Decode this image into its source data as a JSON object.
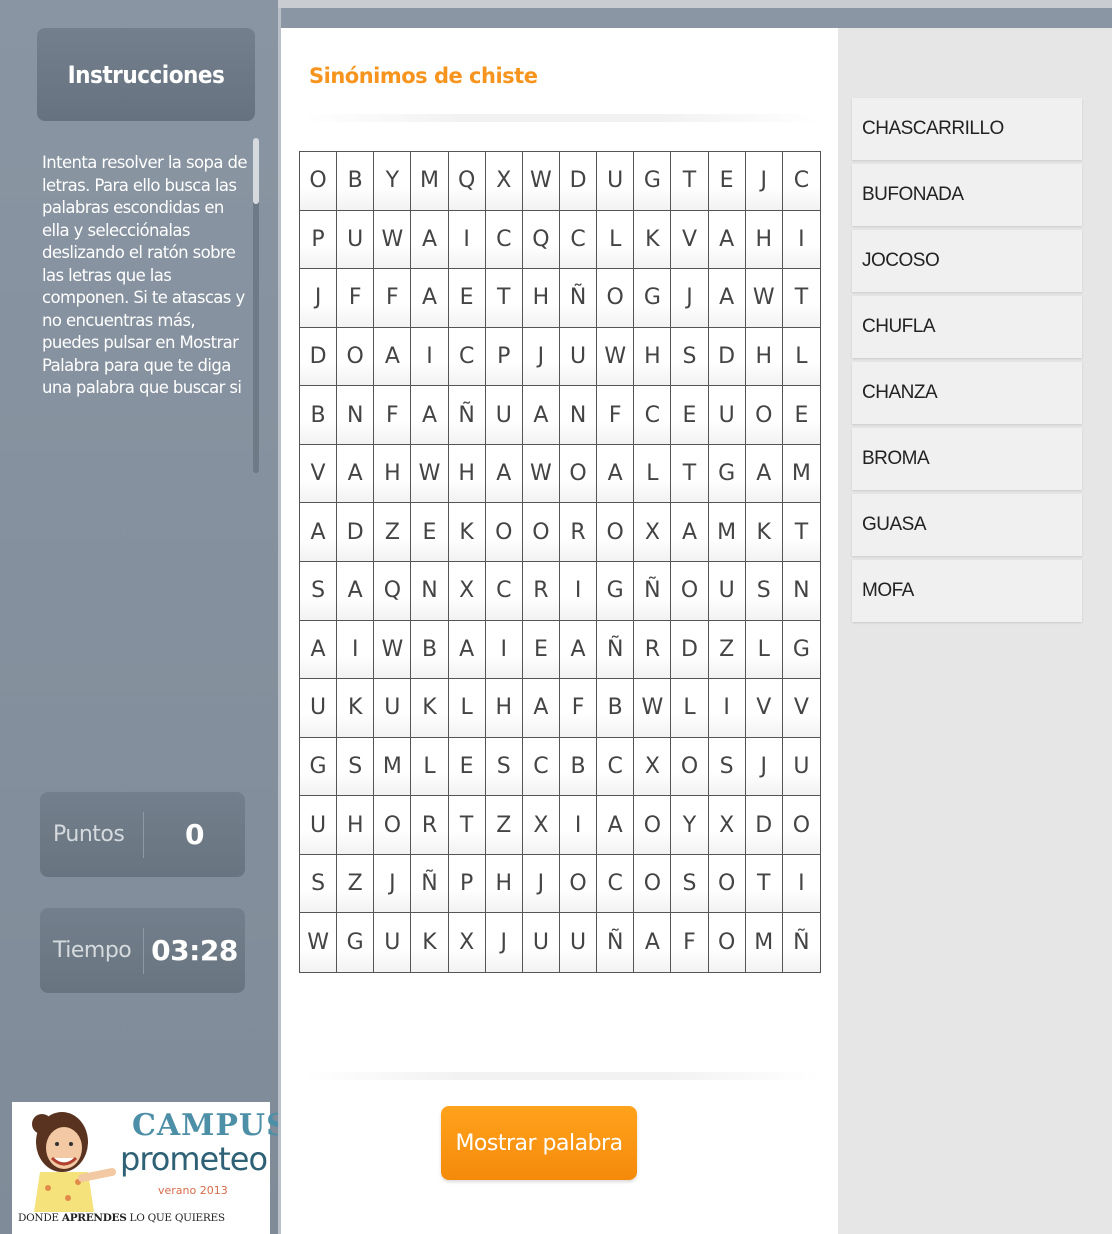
{
  "sidebar": {
    "header": "Instrucciones",
    "instructions": "Intenta resolver la sopa de letras. Para ello busca las palabras escondidas en ella y selecciónalas deslizando el ratón sobre las letras que las componen. Si te atascas y no encuentras más, puedes pulsar en Mostrar Palabra para que te diga una palabra que buscar si",
    "points_label": "Puntos",
    "points_value": "0",
    "time_label": "Tiempo",
    "time_value": "03:28",
    "logo": {
      "campus": "CAMPUS",
      "prometeo": "prometeo",
      "verano": "verano 2013",
      "tagline_pre": "DONDE ",
      "tagline_bold": "APRENDES",
      "tagline_post": " LO QUE QUIERES"
    }
  },
  "main": {
    "title": "Sinónimos de chiste",
    "show_word_button": "Mostrar palabra",
    "grid": [
      [
        "O",
        "B",
        "Y",
        "M",
        "Q",
        "X",
        "W",
        "D",
        "U",
        "G",
        "T",
        "E",
        "J",
        "C"
      ],
      [
        "P",
        "U",
        "W",
        "A",
        "I",
        "C",
        "Q",
        "C",
        "L",
        "K",
        "V",
        "A",
        "H",
        "I"
      ],
      [
        "J",
        "F",
        "F",
        "A",
        "E",
        "T",
        "H",
        "Ñ",
        "O",
        "G",
        "J",
        "A",
        "W",
        "T"
      ],
      [
        "D",
        "O",
        "A",
        "I",
        "C",
        "P",
        "J",
        "U",
        "W",
        "H",
        "S",
        "D",
        "H",
        "L"
      ],
      [
        "B",
        "N",
        "F",
        "A",
        "Ñ",
        "U",
        "A",
        "N",
        "F",
        "C",
        "E",
        "U",
        "O",
        "E"
      ],
      [
        "V",
        "A",
        "H",
        "W",
        "H",
        "A",
        "W",
        "O",
        "A",
        "L",
        "T",
        "G",
        "A",
        "M"
      ],
      [
        "A",
        "D",
        "Z",
        "E",
        "K",
        "O",
        "O",
        "R",
        "O",
        "X",
        "A",
        "M",
        "K",
        "T"
      ],
      [
        "S",
        "A",
        "Q",
        "N",
        "X",
        "C",
        "R",
        "I",
        "G",
        "Ñ",
        "O",
        "U",
        "S",
        "N"
      ],
      [
        "A",
        "I",
        "W",
        "B",
        "A",
        "I",
        "E",
        "A",
        "Ñ",
        "R",
        "D",
        "Z",
        "L",
        "G"
      ],
      [
        "U",
        "K",
        "U",
        "K",
        "L",
        "H",
        "A",
        "F",
        "B",
        "W",
        "L",
        "I",
        "V",
        "V"
      ],
      [
        "G",
        "S",
        "M",
        "L",
        "E",
        "S",
        "C",
        "B",
        "C",
        "X",
        "O",
        "S",
        "J",
        "U"
      ],
      [
        "U",
        "H",
        "O",
        "R",
        "T",
        "Z",
        "X",
        "I",
        "A",
        "O",
        "Y",
        "X",
        "D",
        "O"
      ],
      [
        "S",
        "Z",
        "J",
        "Ñ",
        "P",
        "H",
        "J",
        "O",
        "C",
        "O",
        "S",
        "O",
        "T",
        "I"
      ],
      [
        "W",
        "G",
        "U",
        "K",
        "X",
        "J",
        "U",
        "U",
        "Ñ",
        "A",
        "F",
        "O",
        "M",
        "Ñ"
      ]
    ]
  },
  "words": [
    "CHASCARRILLO",
    "BUFONADA",
    "JOCOSO",
    "CHUFLA",
    "CHANZA",
    "BROMA",
    "GUASA",
    "MOFA"
  ],
  "colors": {
    "accent": "#f7941d",
    "sidebar": "#8a96a3",
    "panel": "#e6e6e6"
  }
}
